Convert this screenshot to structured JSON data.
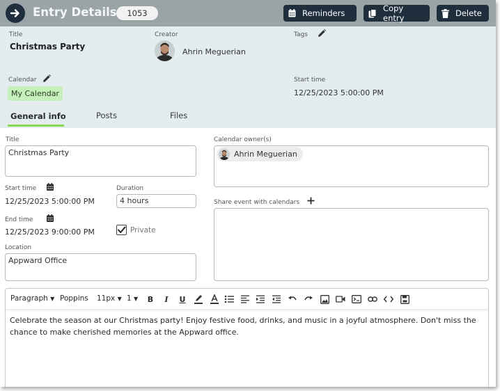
{
  "header": {
    "title": "Entry Details",
    "entry_id": "1053",
    "buttons": {
      "reminders": "Reminders",
      "copy_entry": "Copy entry",
      "delete": "Delete"
    }
  },
  "summary": {
    "title_label": "Title",
    "title_value": "Christmas Party",
    "creator_label": "Creator",
    "creator_name": "Ahrin Meguerian",
    "tags_label": "Tags",
    "calendar_label": "Calendar",
    "calendar_value": "My Calendar",
    "start_label": "Start time",
    "start_value": "12/25/2023 5:00:00 PM"
  },
  "tabs": [
    {
      "label": "General info",
      "active": true
    },
    {
      "label": "Posts",
      "active": false
    },
    {
      "label": "Files",
      "active": false
    }
  ],
  "form": {
    "title_label": "Title",
    "title_value": "Christmas Party",
    "start_label": "Start time",
    "start_value": "12/25/2023 5:00:00 PM",
    "duration_label": "Duration",
    "duration_value": "4 hours",
    "end_label": "End time",
    "end_value": "12/25/2023 9:00:00 PM",
    "private_label": "Private",
    "private_checked": true,
    "location_label": "Location",
    "location_value": "Appward Office",
    "owners_label": "Calendar owner(s)",
    "owner_name": "Ahrin Meguerian",
    "share_label": "Share event with calendars"
  },
  "editor": {
    "format": "Paragraph",
    "font": "Poppins",
    "size": "11px",
    "line_height": "1",
    "body": "Celebrate the season at our Christmas party! Enjoy festive food, drinks, and music in a joyful atmosphere. Don't miss the chance to make cherished memories at the Appward office."
  },
  "colors": {
    "topbar": "#9aa4a7",
    "dark_button": "#1f2e3d",
    "header_bg": "#e3edf0",
    "calendar_chip": "#c5f0b9",
    "tab_accent": "#86d94f"
  }
}
